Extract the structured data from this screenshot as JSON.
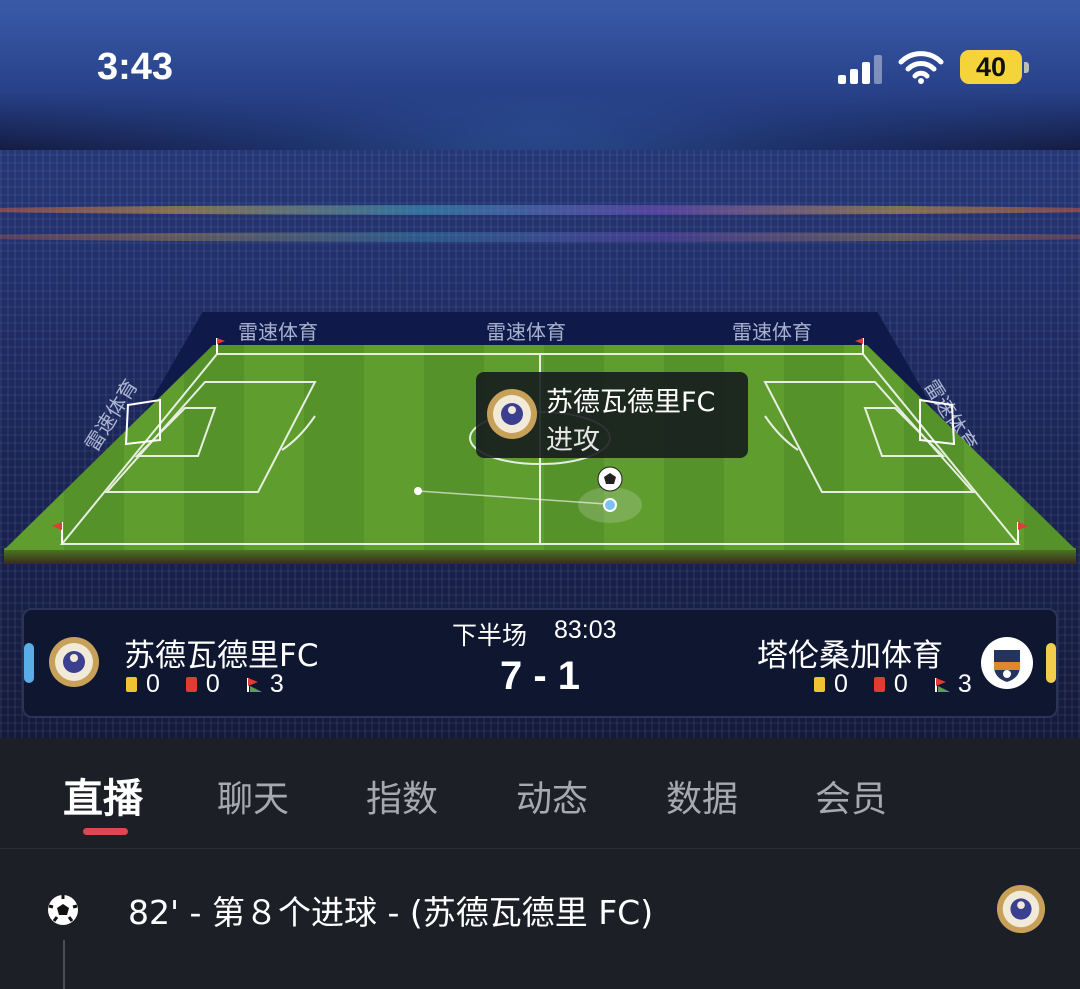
{
  "status_bar": {
    "time": "3:43",
    "battery": "40"
  },
  "sponsor_text": "雷速体育",
  "tooltip": {
    "team": "苏德瓦德里FC",
    "action": "进攻"
  },
  "match": {
    "period": "下半场",
    "clock": "83:03",
    "score": "7 - 1",
    "home": {
      "name": "苏德瓦德里FC",
      "yellow": "0",
      "red": "0",
      "corners": "3",
      "color": "#5aaee8"
    },
    "away": {
      "name": "塔伦桑加体育",
      "yellow": "0",
      "red": "0",
      "corners": "3",
      "color": "#f1cf4a"
    }
  },
  "colors": {
    "yellow_card": "#f1c232",
    "red_card": "#e53935",
    "tab_accent": "#e0464d",
    "pitch": "#5f9d2f"
  },
  "tabs": [
    {
      "label": "直播",
      "active": true
    },
    {
      "label": "聊天",
      "active": false
    },
    {
      "label": "指数",
      "active": false
    },
    {
      "label": "动态",
      "active": false
    },
    {
      "label": "数据",
      "active": false
    },
    {
      "label": "会员",
      "active": false
    }
  ],
  "events": [
    {
      "text": "82' - 第８个进球 - (苏德瓦德里 FC)",
      "icon": "soccer-ball-icon"
    }
  ]
}
